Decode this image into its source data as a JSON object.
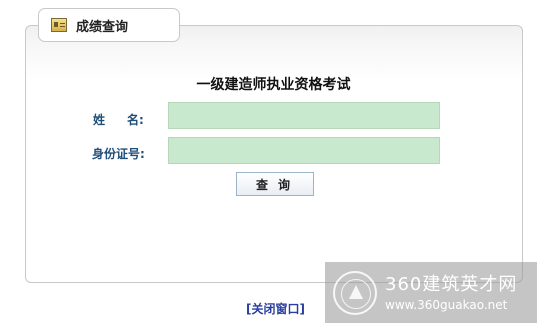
{
  "tab": {
    "title": "成绩查询",
    "icon": "certificate-icon"
  },
  "form": {
    "exam_title": "一级建造师执业资格考试",
    "name_label_a": "姓",
    "name_label_b": "名:",
    "id_label": "身份证号:",
    "name_value": "",
    "id_value": "",
    "input_bg": "#c9e9cf",
    "query_button": "查询"
  },
  "footer": {
    "close_link": "[关闭窗口]"
  },
  "watermark": {
    "name": "360建筑英才网",
    "url": "www.360guakao.net"
  }
}
